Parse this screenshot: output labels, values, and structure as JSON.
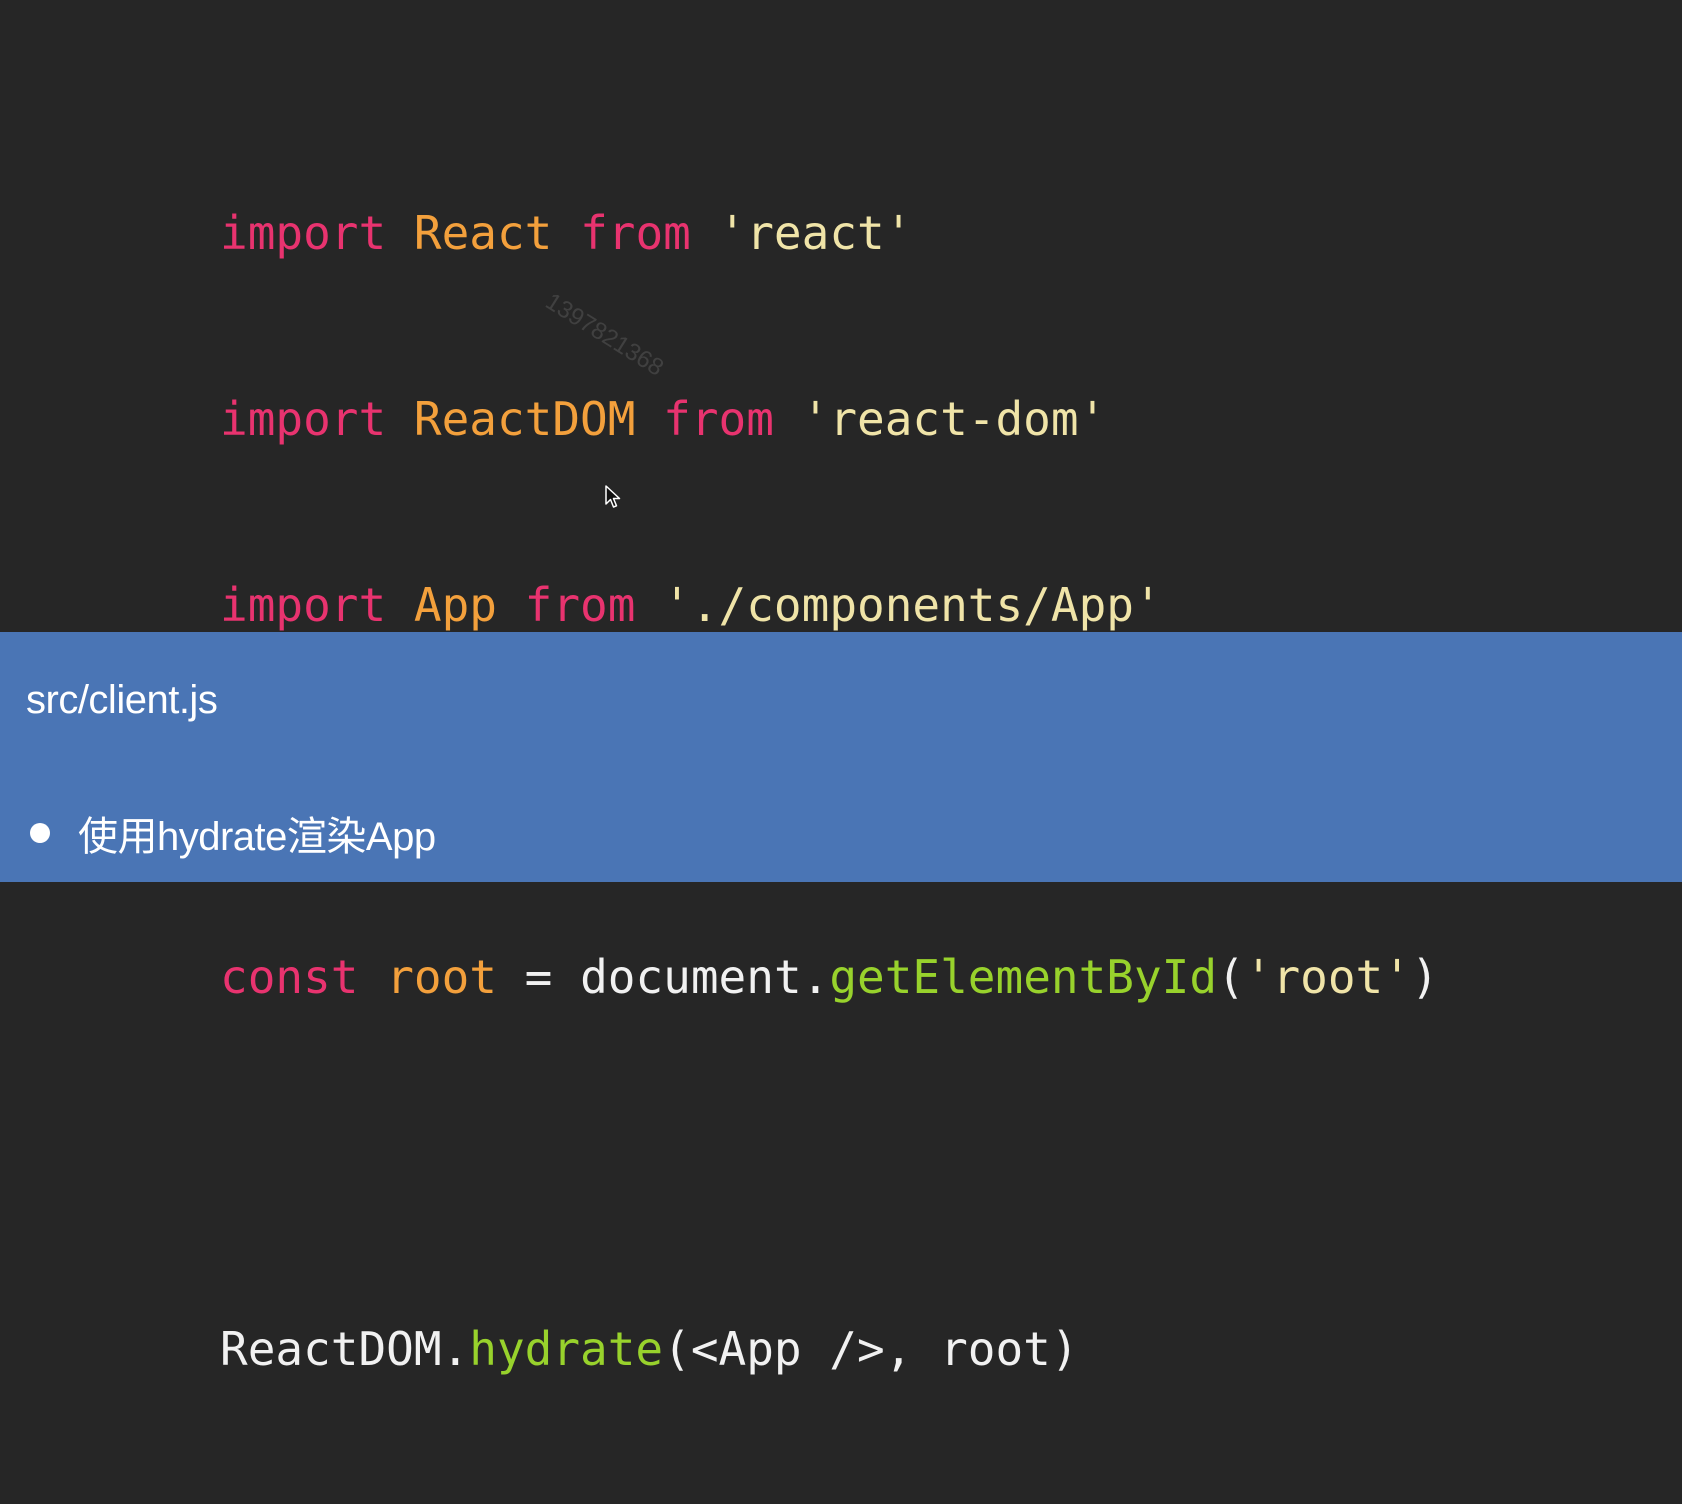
{
  "code": {
    "line1": {
      "kw": "import",
      "id": "React",
      "kw2": "from",
      "str": "'react'"
    },
    "line2": {
      "kw": "import",
      "id": "ReactDOM",
      "kw2": "from",
      "str": "'react-dom'"
    },
    "line3": {
      "kw": "import",
      "id": "App",
      "kw2": "from",
      "str": "'./components/App'"
    },
    "line4": {
      "kw": "const",
      "id": "root",
      "op": "=",
      "obj": "document.",
      "fn": "getElementById",
      "open": "(",
      "str": "'root'",
      "close": ")"
    },
    "line5": {
      "obj": "ReactDOM.",
      "fn": "hydrate",
      "rest": "(<App />, root)"
    }
  },
  "watermark": "1397821368",
  "footer": {
    "filename": "src/client.js",
    "bullet": "使用hydrate渲染App"
  },
  "colors": {
    "code_bg": "#262626",
    "footer_bg": "#4a75b5",
    "keyword": "#e8336f",
    "identifier": "#f3a03c",
    "string": "#f0e4a8",
    "function": "#98d22c"
  }
}
